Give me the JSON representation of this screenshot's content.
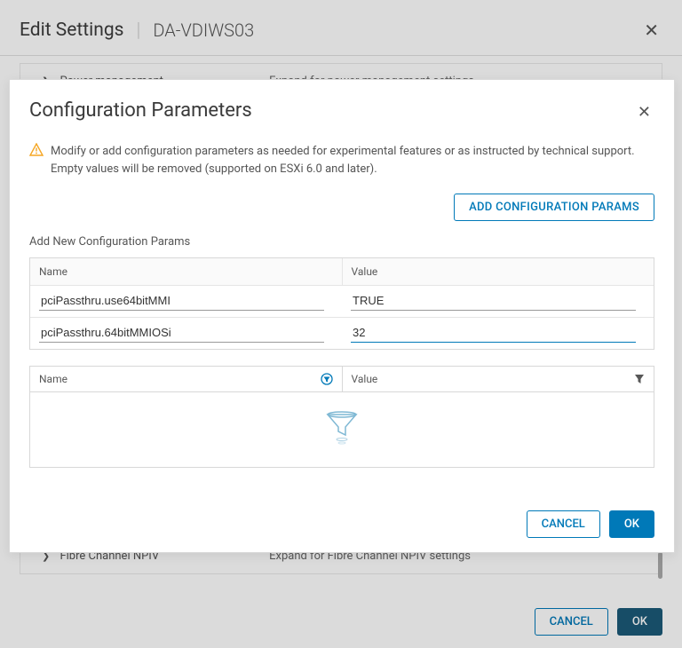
{
  "bg": {
    "title": "Edit Settings",
    "subtitle": "DA-VDIWS03",
    "row1": {
      "label": "Power management",
      "desc": "Expand for power management settings"
    },
    "row2": {
      "label": "Fibre Channel NPIV",
      "desc": "Expand for Fibre Channel NPIV settings"
    },
    "cancel": "CANCEL",
    "ok": "OK"
  },
  "modal": {
    "title": "Configuration Parameters",
    "warning": "Modify or add configuration parameters as needed for experimental features or as instructed by technical support. Empty values will be removed (supported on ESXi 6.0 and later).",
    "addButton": "ADD CONFIGURATION PARAMS",
    "sectionLabel": "Add New Configuration Params",
    "headers": {
      "name": "Name",
      "value": "Value"
    },
    "rows": [
      {
        "name": "pciPassthru.use64bitMMI",
        "value": "TRUE"
      },
      {
        "name": "pciPassthru.64bitMMIOSi",
        "value": "32"
      }
    ],
    "filterHeaders": {
      "name": "Name",
      "value": "Value"
    },
    "cancel": "CANCEL",
    "ok": "OK"
  }
}
